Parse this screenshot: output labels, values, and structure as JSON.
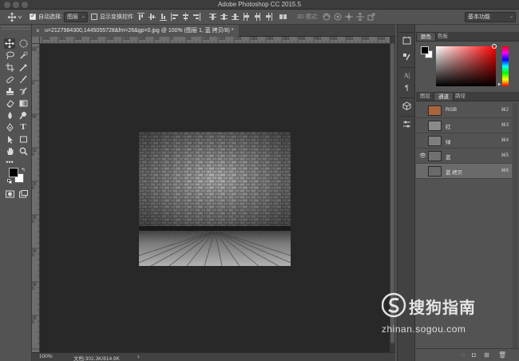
{
  "window": {
    "title": "Adobe Photoshop CC 2015.5"
  },
  "options_bar": {
    "auto_select_label": "自动选择:",
    "auto_select_target": "图层",
    "show_transform_label": "显示变换控件",
    "mode_3d_label": "3D 模式:",
    "workspace": "基本功能"
  },
  "document": {
    "tab_title": "u=2127984300,1445055728&fm=26&gp=0.jpg @ 100% (图层 1, 蓝 拷贝/8) *",
    "close_symbol": "×"
  },
  "ruler_h_labels": [
    "400",
    "350",
    "300",
    "250",
    "200",
    "150",
    "100",
    "50",
    "0",
    "50",
    "100",
    "150",
    "200",
    "250",
    "300",
    "350",
    "400",
    "450",
    "500",
    "550",
    "600",
    "650"
  ],
  "ruler_v_labels": [
    "50",
    "0",
    "50",
    "100",
    "150",
    "200",
    "250",
    "300",
    "350"
  ],
  "status": {
    "zoom": "100%",
    "doc_info": "文档:302.3K/814.9K",
    "arrow": "›"
  },
  "color_panel": {
    "tabs": [
      "颜色",
      "色板"
    ]
  },
  "channels_panel": {
    "tabs": [
      "图层",
      "通道",
      "路径"
    ],
    "rows": [
      {
        "name": "RGB",
        "key": "⌘2",
        "visible": false
      },
      {
        "name": "红",
        "key": "⌘3",
        "visible": false
      },
      {
        "name": "绿",
        "key": "⌘4",
        "visible": false
      },
      {
        "name": "蓝",
        "key": "⌘5",
        "visible": true
      },
      {
        "name": "蓝 拷贝",
        "key": "⌘6",
        "visible": false
      }
    ]
  },
  "watermark": {
    "brand": "搜狗指南",
    "url": "zhinan.sogou.com"
  },
  "colors": {
    "chrome": "#535353",
    "canvas_bg": "#282828",
    "channel_rgb_thumb": "#a8643c",
    "foreground": "#000000",
    "background": "#ffffff"
  }
}
